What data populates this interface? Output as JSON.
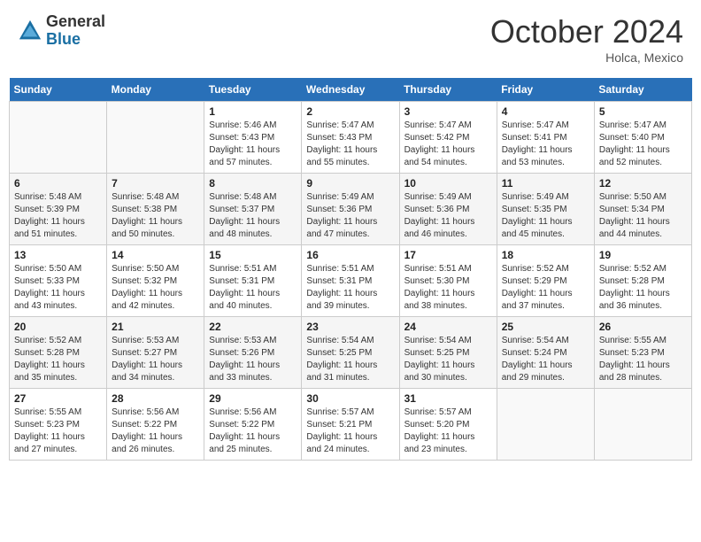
{
  "header": {
    "logo_general": "General",
    "logo_blue": "Blue",
    "month_title": "October 2024",
    "location": "Holca, Mexico"
  },
  "calendar": {
    "weekdays": [
      "Sunday",
      "Monday",
      "Tuesday",
      "Wednesday",
      "Thursday",
      "Friday",
      "Saturday"
    ],
    "rows": [
      [
        {
          "day": "",
          "info": ""
        },
        {
          "day": "",
          "info": ""
        },
        {
          "day": "1",
          "info": "Sunrise: 5:46 AM\nSunset: 5:43 PM\nDaylight: 11 hours and 57 minutes."
        },
        {
          "day": "2",
          "info": "Sunrise: 5:47 AM\nSunset: 5:43 PM\nDaylight: 11 hours and 55 minutes."
        },
        {
          "day": "3",
          "info": "Sunrise: 5:47 AM\nSunset: 5:42 PM\nDaylight: 11 hours and 54 minutes."
        },
        {
          "day": "4",
          "info": "Sunrise: 5:47 AM\nSunset: 5:41 PM\nDaylight: 11 hours and 53 minutes."
        },
        {
          "day": "5",
          "info": "Sunrise: 5:47 AM\nSunset: 5:40 PM\nDaylight: 11 hours and 52 minutes."
        }
      ],
      [
        {
          "day": "6",
          "info": "Sunrise: 5:48 AM\nSunset: 5:39 PM\nDaylight: 11 hours and 51 minutes."
        },
        {
          "day": "7",
          "info": "Sunrise: 5:48 AM\nSunset: 5:38 PM\nDaylight: 11 hours and 50 minutes."
        },
        {
          "day": "8",
          "info": "Sunrise: 5:48 AM\nSunset: 5:37 PM\nDaylight: 11 hours and 48 minutes."
        },
        {
          "day": "9",
          "info": "Sunrise: 5:49 AM\nSunset: 5:36 PM\nDaylight: 11 hours and 47 minutes."
        },
        {
          "day": "10",
          "info": "Sunrise: 5:49 AM\nSunset: 5:36 PM\nDaylight: 11 hours and 46 minutes."
        },
        {
          "day": "11",
          "info": "Sunrise: 5:49 AM\nSunset: 5:35 PM\nDaylight: 11 hours and 45 minutes."
        },
        {
          "day": "12",
          "info": "Sunrise: 5:50 AM\nSunset: 5:34 PM\nDaylight: 11 hours and 44 minutes."
        }
      ],
      [
        {
          "day": "13",
          "info": "Sunrise: 5:50 AM\nSunset: 5:33 PM\nDaylight: 11 hours and 43 minutes."
        },
        {
          "day": "14",
          "info": "Sunrise: 5:50 AM\nSunset: 5:32 PM\nDaylight: 11 hours and 42 minutes."
        },
        {
          "day": "15",
          "info": "Sunrise: 5:51 AM\nSunset: 5:31 PM\nDaylight: 11 hours and 40 minutes."
        },
        {
          "day": "16",
          "info": "Sunrise: 5:51 AM\nSunset: 5:31 PM\nDaylight: 11 hours and 39 minutes."
        },
        {
          "day": "17",
          "info": "Sunrise: 5:51 AM\nSunset: 5:30 PM\nDaylight: 11 hours and 38 minutes."
        },
        {
          "day": "18",
          "info": "Sunrise: 5:52 AM\nSunset: 5:29 PM\nDaylight: 11 hours and 37 minutes."
        },
        {
          "day": "19",
          "info": "Sunrise: 5:52 AM\nSunset: 5:28 PM\nDaylight: 11 hours and 36 minutes."
        }
      ],
      [
        {
          "day": "20",
          "info": "Sunrise: 5:52 AM\nSunset: 5:28 PM\nDaylight: 11 hours and 35 minutes."
        },
        {
          "day": "21",
          "info": "Sunrise: 5:53 AM\nSunset: 5:27 PM\nDaylight: 11 hours and 34 minutes."
        },
        {
          "day": "22",
          "info": "Sunrise: 5:53 AM\nSunset: 5:26 PM\nDaylight: 11 hours and 33 minutes."
        },
        {
          "day": "23",
          "info": "Sunrise: 5:54 AM\nSunset: 5:25 PM\nDaylight: 11 hours and 31 minutes."
        },
        {
          "day": "24",
          "info": "Sunrise: 5:54 AM\nSunset: 5:25 PM\nDaylight: 11 hours and 30 minutes."
        },
        {
          "day": "25",
          "info": "Sunrise: 5:54 AM\nSunset: 5:24 PM\nDaylight: 11 hours and 29 minutes."
        },
        {
          "day": "26",
          "info": "Sunrise: 5:55 AM\nSunset: 5:23 PM\nDaylight: 11 hours and 28 minutes."
        }
      ],
      [
        {
          "day": "27",
          "info": "Sunrise: 5:55 AM\nSunset: 5:23 PM\nDaylight: 11 hours and 27 minutes."
        },
        {
          "day": "28",
          "info": "Sunrise: 5:56 AM\nSunset: 5:22 PM\nDaylight: 11 hours and 26 minutes."
        },
        {
          "day": "29",
          "info": "Sunrise: 5:56 AM\nSunset: 5:22 PM\nDaylight: 11 hours and 25 minutes."
        },
        {
          "day": "30",
          "info": "Sunrise: 5:57 AM\nSunset: 5:21 PM\nDaylight: 11 hours and 24 minutes."
        },
        {
          "day": "31",
          "info": "Sunrise: 5:57 AM\nSunset: 5:20 PM\nDaylight: 11 hours and 23 minutes."
        },
        {
          "day": "",
          "info": ""
        },
        {
          "day": "",
          "info": ""
        }
      ]
    ]
  }
}
